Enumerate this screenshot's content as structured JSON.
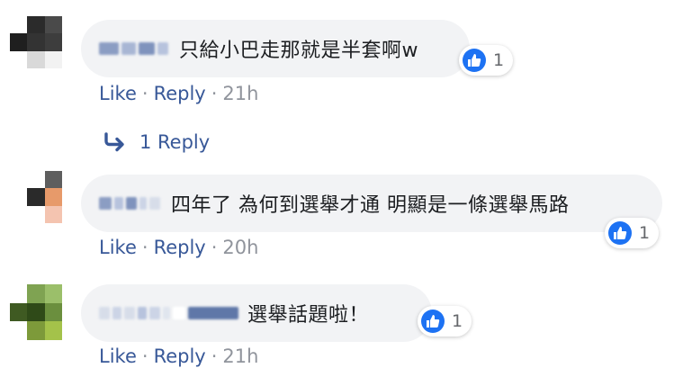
{
  "comments": [
    {
      "text": "只給小巴走那就是半套啊w",
      "reactions": "1",
      "actions": {
        "like": "Like",
        "reply": "Reply",
        "dot": "·",
        "time": "21h"
      },
      "replies_label": "1 Reply"
    },
    {
      "text": "四年了 為何到選舉才通 明顯是一條選舉馬路",
      "reactions": "1",
      "actions": {
        "like": "Like",
        "reply": "Reply",
        "dot": "·",
        "time": "20h"
      }
    },
    {
      "text": "選舉話題啦！",
      "reactions": "1",
      "actions": {
        "like": "Like",
        "reply": "Reply",
        "dot": "·",
        "time": "21h"
      }
    }
  ],
  "icons": {
    "like": "thumbs-up-icon",
    "reply_arrow": "reply-arrow-icon"
  },
  "colors": {
    "link": "#385898",
    "meta": "#90949c",
    "like_blue": "#1d72f3",
    "bubble": "#f2f3f5"
  }
}
